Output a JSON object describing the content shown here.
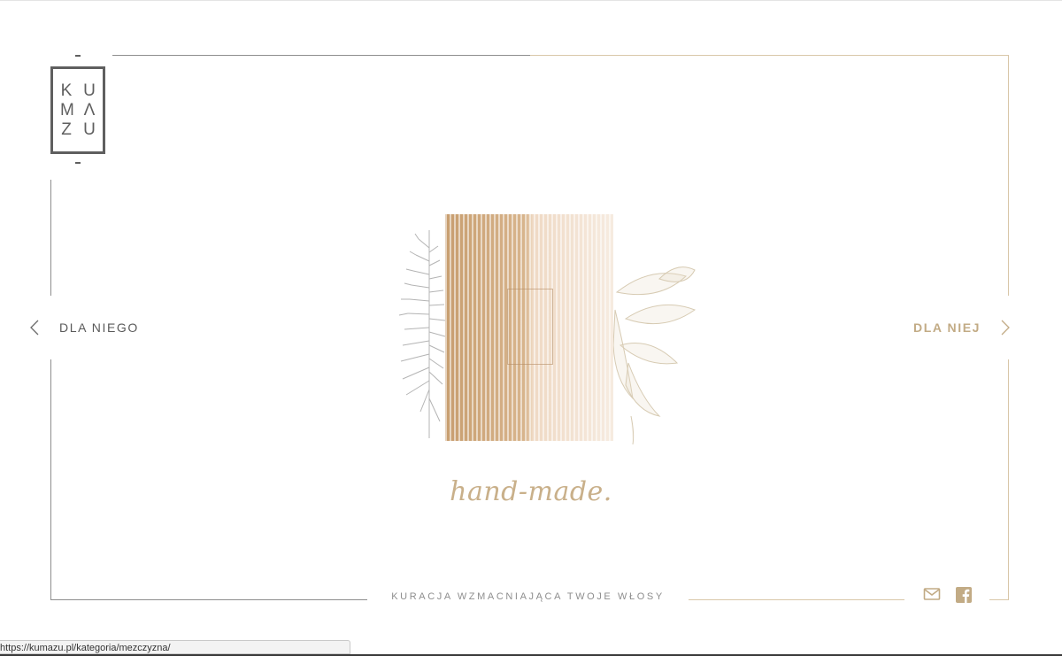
{
  "brand": {
    "logo_rows": [
      [
        "K",
        "U"
      ],
      [
        "M",
        "Λ"
      ],
      [
        "Z",
        "U"
      ]
    ],
    "logo_name": "KUMAZU"
  },
  "nav": {
    "left_label": "DLA NIEGO",
    "right_label": "DLA NIEJ"
  },
  "hero": {
    "tagline": "hand-made."
  },
  "footer": {
    "subtitle": "KURACJA WZMACNIAJĄCA TWOJE WŁOSY",
    "social_icons": [
      "mail-icon",
      "facebook-icon"
    ]
  },
  "statusbar": {
    "url": "https://kumazu.pl/kategoria/mezczyzna/"
  },
  "colors": {
    "gold": "#c2ab85",
    "gray": "#5f5f5f",
    "frame_gold": "#d9c7a9",
    "frame_gray": "#8e8e8e"
  }
}
